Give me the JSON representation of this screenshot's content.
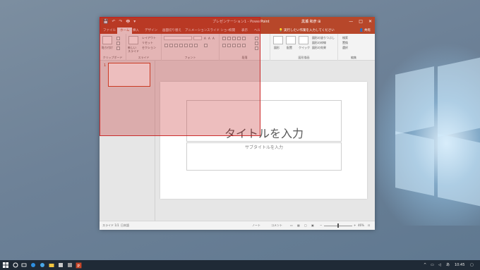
{
  "window": {
    "title": "プレゼンテーション1 - PowerPoint",
    "user": "黒瀬 和彦 ⊞",
    "controls": [
      "—",
      "□",
      "✕"
    ],
    "quick_access": [
      "💾",
      "↶",
      "↷",
      "🖶",
      "▾"
    ]
  },
  "tabs": [
    {
      "label": "ファイル"
    },
    {
      "label": "ホーム"
    },
    {
      "label": "挿入"
    },
    {
      "label": "デザイン"
    },
    {
      "label": "画面切り替え"
    },
    {
      "label": "アニメーション"
    },
    {
      "label": "スライド ショー"
    },
    {
      "label": "校閲"
    },
    {
      "label": "表示"
    },
    {
      "label": "ヘル"
    }
  ],
  "tell_me": "実行したい作業を入力してください",
  "share": "共有",
  "ribbon": {
    "clipboard": {
      "label": "クリップボード",
      "paste": "貼り付け"
    },
    "slides": {
      "label": "スライド",
      "new_slide": "新しい スライド",
      "layout": "レイアウト",
      "reset": "リセット",
      "section": "セクション"
    },
    "font": {
      "label": "フォント",
      "size_buttons": [
        "A",
        "A",
        "A"
      ]
    },
    "paragraph": {
      "label": "段落"
    },
    "drawing": {
      "label": "図形描画",
      "items": [
        "図形",
        "配置",
        "クイック",
        "図形の塗りつぶし",
        "図形の枠線",
        "図形の効果"
      ]
    },
    "editing": {
      "label": "編集",
      "items": [
        "検索",
        "置換",
        "選択"
      ]
    }
  },
  "thumbnail_number": "1",
  "slide": {
    "title_placeholder": "タイトルを入力",
    "subtitle_placeholder": "サブタイトルを入力"
  },
  "status": {
    "slide_info": "スライド 1/1",
    "language": "日本語",
    "notes": "ノート",
    "comments": "コメント",
    "zoom": "46%"
  },
  "taskbar": {
    "tray_text": "あ",
    "time": "10:45"
  }
}
